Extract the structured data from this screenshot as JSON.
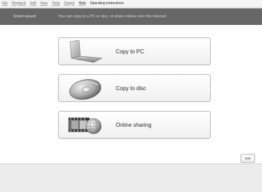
{
  "menu": {
    "items": [
      {
        "label": "File"
      },
      {
        "label": "Playback"
      },
      {
        "label": "Edit"
      },
      {
        "label": "View"
      },
      {
        "label": "Tools"
      },
      {
        "label": "Output"
      },
      {
        "label": "Help"
      },
      {
        "label": "Operating instructions"
      }
    ]
  },
  "header": {
    "title": "Smart wizard",
    "description": "You can copy to a PC or disc, or share videos over the Internet."
  },
  "actions": {
    "copy_pc": {
      "label": "Copy to PC",
      "icon": "laptop-icon"
    },
    "copy_disc": {
      "label": "Copy to disc",
      "icon": "disc-icon"
    },
    "online": {
      "label": "Online sharing",
      "icon": "film-globe-icon"
    }
  },
  "footer": {
    "exit_label": "Exit"
  }
}
